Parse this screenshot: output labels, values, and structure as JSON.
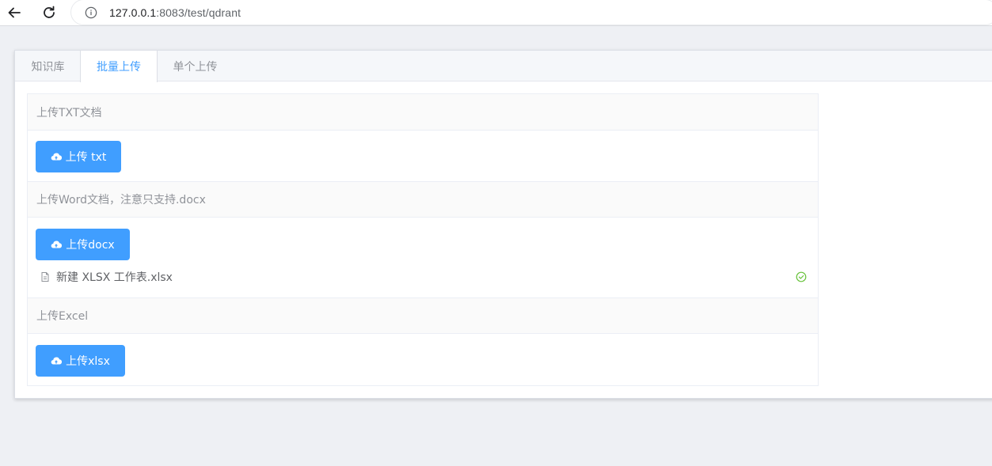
{
  "browser": {
    "url_host": "127.0.0.1",
    "url_rest": ":8083/test/qdrant"
  },
  "tabs": [
    {
      "label": "知识库",
      "active": false
    },
    {
      "label": "批量上传",
      "active": true
    },
    {
      "label": "单个上传",
      "active": false
    }
  ],
  "sections": [
    {
      "title": "上传TXT文档",
      "button_label": "上传 txt"
    },
    {
      "title": "上传Word文档，注意只支持.docx",
      "button_label": "上传docx",
      "files": [
        {
          "name": "新建 XLSX 工作表.xlsx",
          "status": "success"
        }
      ]
    },
    {
      "title": "上传Excel",
      "button_label": "上传xlsx"
    }
  ],
  "icons": {
    "back": "arrow-left-icon",
    "reload": "reload-icon",
    "info": "info-icon",
    "upload": "cloud-upload-icon",
    "file": "document-icon",
    "success": "circle-check-icon"
  },
  "colors": {
    "primary": "#409eff",
    "success": "#67c23a",
    "page_bg": "#eef0f4"
  }
}
